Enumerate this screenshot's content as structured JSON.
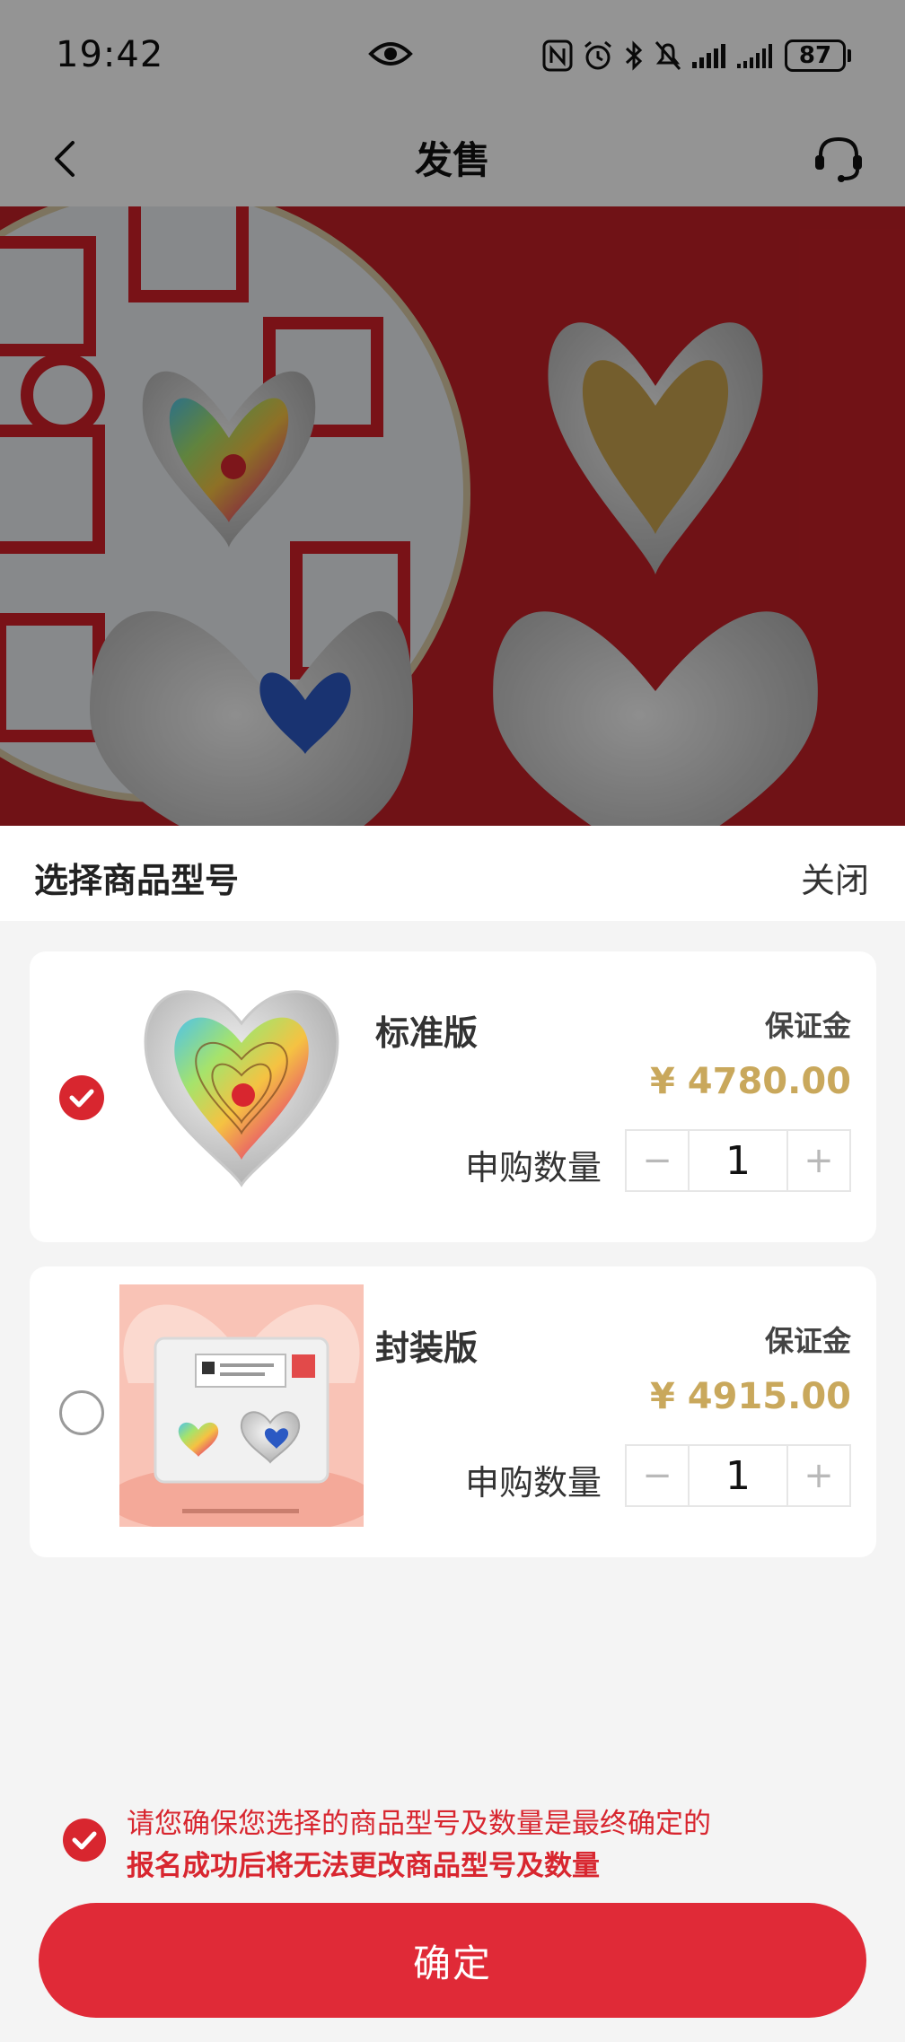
{
  "status_bar": {
    "time": "19:42",
    "battery": "87"
  },
  "nav": {
    "title": "发售"
  },
  "sheet": {
    "title": "选择商品型号",
    "close_label": "关闭"
  },
  "variants": [
    {
      "name": "标准版",
      "deposit_label": "保证金",
      "price": "¥ 4780.00",
      "qty_label": "申购数量",
      "qty": "1",
      "selected": true
    },
    {
      "name": "封装版",
      "deposit_label": "保证金",
      "price": "¥ 4915.00",
      "qty_label": "申购数量",
      "qty": "1",
      "selected": false
    }
  ],
  "stepper": {
    "minus": "−",
    "plus": "+"
  },
  "confirm_notice": {
    "line1": "请您确保您选择的商品型号及数量是最终确定的",
    "line2": "报名成功后将无法更改商品型号及数量",
    "checked": true
  },
  "confirm_button": {
    "label": "确定"
  },
  "colors": {
    "accent": "#e02a37",
    "price": "#c9a85c",
    "banner": "#c21f26"
  }
}
